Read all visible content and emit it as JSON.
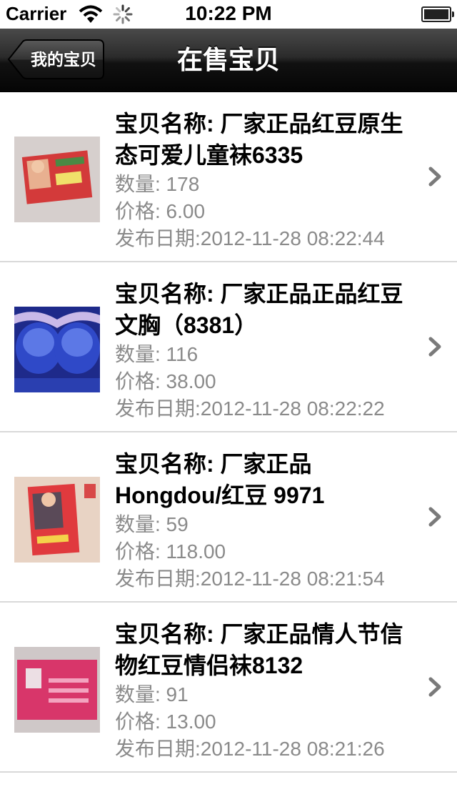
{
  "status_bar": {
    "carrier": "Carrier",
    "time": "10:22 PM"
  },
  "nav": {
    "back_label": "我的宝贝",
    "title": "在售宝贝"
  },
  "items": [
    {
      "name": "宝贝名称: 厂家正品红豆原生态可爱儿童袜6335",
      "quantity": "数量: 178",
      "price": "价格: 6.00",
      "date": "发布日期:2012-11-28 08:22:44"
    },
    {
      "name": "宝贝名称: 厂家正品正品红豆文胸（8381）",
      "quantity": "数量: 116",
      "price": "价格: 38.00",
      "date": "发布日期:2012-11-28 08:22:22"
    },
    {
      "name": "宝贝名称: 厂家正品Hongdou/红豆 9971",
      "quantity": "数量: 59",
      "price": "价格: 118.00",
      "date": "发布日期:2012-11-28 08:21:54"
    },
    {
      "name": "宝贝名称: 厂家正品情人节信物红豆情侣袜8132",
      "quantity": "数量: 91",
      "price": "价格: 13.00",
      "date": "发布日期:2012-11-28 08:21:26"
    }
  ]
}
